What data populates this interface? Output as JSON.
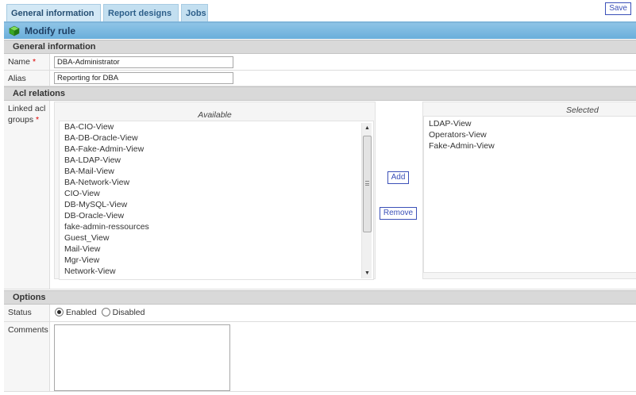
{
  "tabs": [
    {
      "label": "General information",
      "active": true
    },
    {
      "label": "Report designs",
      "active": false
    },
    {
      "label": "Jobs",
      "active": false
    }
  ],
  "save_label": "Save",
  "header": {
    "title": "Modify rule",
    "icon": "green-cube-icon"
  },
  "general": {
    "title": "General information",
    "name_label": "Name",
    "name_value": "DBA-Administrator",
    "alias_label": "Alias",
    "alias_value": "Reporting for DBA",
    "required_mark": "*"
  },
  "acl": {
    "title": "Acl relations",
    "label_line1": "Linked acl",
    "label_line2": "groups",
    "available_title": "Available",
    "available": [
      "BA-CIO-View",
      "BA-DB-Oracle-View",
      "BA-Fake-Admin-View",
      "BA-LDAP-View",
      "BA-Mail-View",
      "BA-Network-View",
      "CIO-View",
      "DB-MySQL-View",
      "DB-Oracle-View",
      "fake-admin-ressources",
      "Guest_View",
      "Mail-View",
      "Mgr-View",
      "Network-View"
    ],
    "add_label": "Add",
    "remove_label": "Remove",
    "selected_title": "Selected",
    "selected": [
      "LDAP-View",
      "Operators-View",
      "Fake-Admin-View"
    ]
  },
  "options": {
    "title": "Options",
    "status_label": "Status",
    "enabled_label": "Enabled",
    "disabled_label": "Disabled",
    "status_value": "Enabled",
    "comments_label": "Comments",
    "comments_value": ""
  },
  "colors": {
    "tab_bg": "#c3dff0",
    "header_bar": "#7fb9e0",
    "section_bg": "#d9d9d9",
    "button_border": "#3b50b8",
    "required": "#dd0000"
  }
}
